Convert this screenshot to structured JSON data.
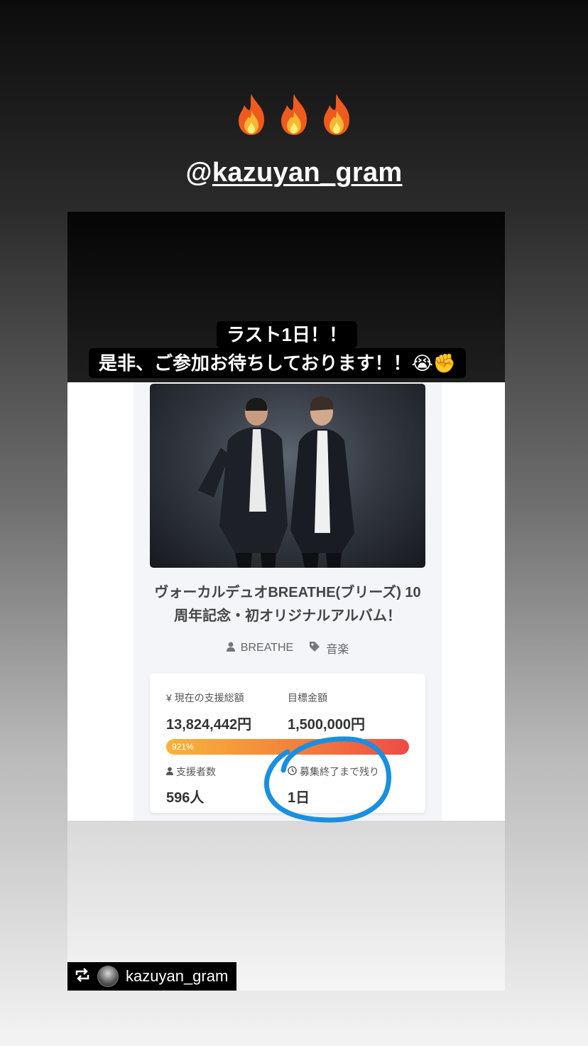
{
  "story": {
    "emojis": [
      "fire-icon",
      "fire-icon",
      "fire-icon"
    ],
    "mention_prefix": "@",
    "mention_handle": "kazuyan_gram"
  },
  "sticker": {
    "line1": "ラスト1日！！",
    "line2": "是非、ご参加お待ちしております！！😭✊"
  },
  "project": {
    "title_line1": "ヴォーカルデュオBREATHE(ブリーズ) 10",
    "title_line2": "周年記念・初オリジナルアルバム！",
    "owner": "BREATHE",
    "category": "音楽",
    "stats": {
      "current_label": "¥ 現在の支援総額",
      "current_value": "13,824,442円",
      "goal_label": "目標金額",
      "goal_value": "1,500,000円",
      "progress_label": "921%",
      "progress_percent": 921,
      "supporters_label": "支援者数",
      "supporters_value": "596人",
      "remaining_label": "募集終了まで残り",
      "remaining_value": "1日"
    }
  },
  "repost": {
    "username": "kazuyan_gram"
  },
  "colors": {
    "circle_annotation": "#1a8fe0",
    "progress_start": "#f6b53a",
    "progress_end": "#ee4b47"
  }
}
